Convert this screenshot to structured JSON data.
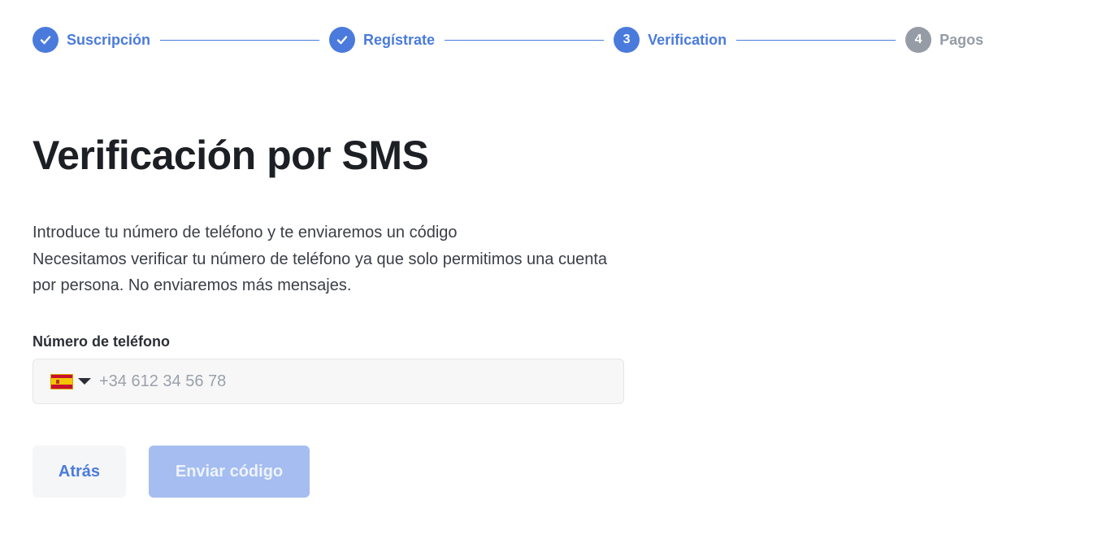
{
  "stepper": {
    "steps": [
      {
        "label": "Suscripción",
        "state": "done",
        "number": "1"
      },
      {
        "label": "Regístrate",
        "state": "done",
        "number": "2"
      },
      {
        "label": "Verification",
        "state": "active",
        "number": "3"
      },
      {
        "label": "Pagos",
        "state": "pending",
        "number": "4"
      }
    ]
  },
  "main": {
    "title": "Verificación por SMS",
    "description_line1": "Introduce tu número de teléfono y te enviaremos un código",
    "description_line2": "Necesitamos verificar tu número de teléfono ya que solo permitimos una cuenta por persona. No enviaremos más mensajes."
  },
  "phone": {
    "label": "Número de teléfono",
    "country_icon": "spain-flag-icon",
    "value": "",
    "placeholder": "+34 612 34 56 78"
  },
  "actions": {
    "back_label": "Atrás",
    "send_label": "Enviar código"
  },
  "colors": {
    "accent": "#4a7bdc",
    "pending": "#959ca6",
    "disabled_button": "#a5bdf0"
  }
}
